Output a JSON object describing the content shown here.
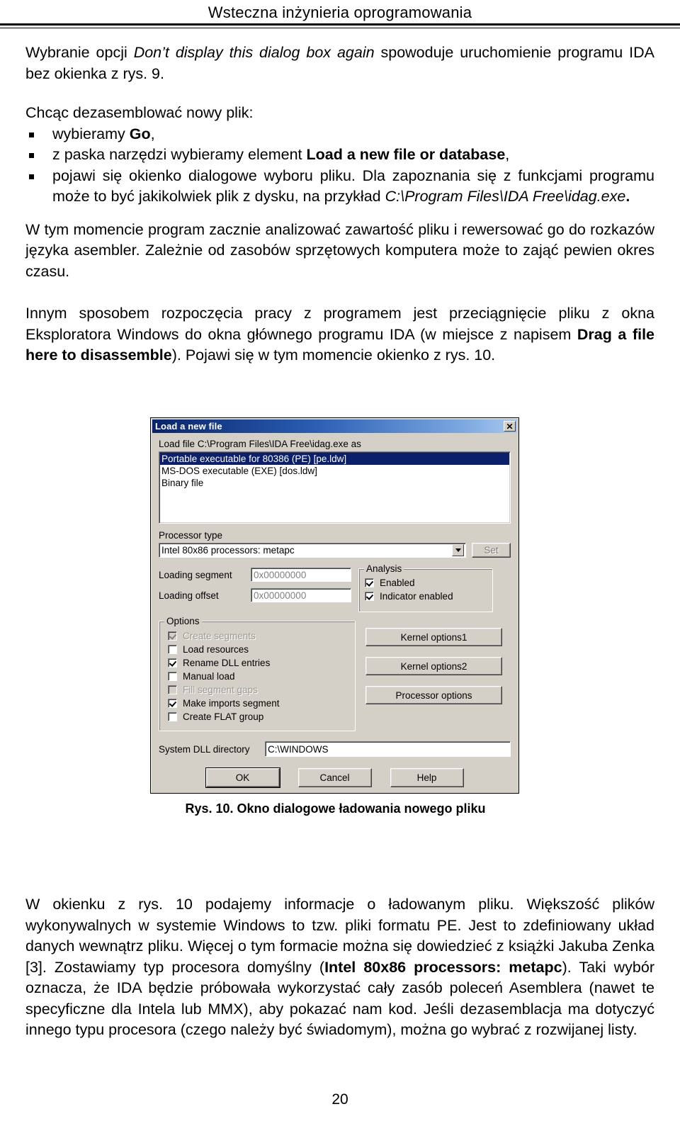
{
  "header": {
    "running_title": "Wsteczna inżynieria oprogramowania"
  },
  "body": {
    "para1_a": "Wybranie opcji ",
    "para1_italic": "Don’t display this dialog box again",
    "para1_b": " spowoduje uruchomienie programu IDA bez okienka z rys. 9.",
    "intro_list": "Chcąc dezasemblować nowy plik:",
    "bullets": [
      {
        "pre": "wybieramy ",
        "bold": "Go",
        "post": ","
      },
      {
        "pre": "z paska narzędzi wybieramy element ",
        "bold": "Load a new file or database",
        "post": ","
      },
      {
        "pre": "pojawi się okienko dialogowe wyboru pliku. Dla zapoznania się z funkcjami programu może to być jakikolwiek plik z dysku, na przykład ",
        "italic": "C:\\Program Files\\IDA Free\\idag.exe",
        "post": "."
      }
    ],
    "para2": "W tym momencie program zacznie analizować zawartość pliku i rewersować go do rozkazów języka asembler. Zależnie od zasobów sprzętowych komputera może to zająć pewien okres czasu.",
    "para3_a": "Innym sposobem rozpoczęcia pracy z programem jest przeciągnięcie pliku z okna Eksploratora Windows do okna głównego programu IDA (w miejsce z napisem ",
    "para3_bold": "Drag a file here to disassemble",
    "para3_b": "). Pojawi się w tym momencie okienko z rys. 10.",
    "para4_a": "W okienku z rys. 10 podajemy informacje o ładowanym pliku. Większość plików wykonywalnych w systemie Windows to tzw. pliki formatu PE. Jest to zdefiniowany układ danych wewnątrz pliku. Więcej o tym formacie można się dowiedzieć z książki Jakuba Zenka [3]. Zostawiamy typ procesora domyślny (",
    "para4_bold": "Intel 80x86 processors: metapc",
    "para4_b": "). Taki wybór oznacza, że IDA będzie próbowała wykorzystać cały zasób poleceń Asemblera (nawet te specyficzne dla Intela lub MMX), aby pokazać nam kod. Jeśli dezasemblacja ma dotyczyć innego typu procesora (czego należy być świadomym), można go wybrać z rozwijanej listy."
  },
  "figure": {
    "caption": "Rys.  10. Okno dialogowe ładowania nowego pliku",
    "dialog": {
      "title": "Load a new file",
      "close_icon": "✕",
      "load_file_label": "Load file C:\\Program Files\\IDA Free\\idag.exe as",
      "file_types": [
        {
          "label": "Portable executable for 80386 (PE) [pe.ldw]",
          "selected": true
        },
        {
          "label": "MS-DOS executable (EXE) [dos.ldw]",
          "selected": false
        },
        {
          "label": "Binary file",
          "selected": false
        }
      ],
      "processor_type_label": "Processor type",
      "processor_type_value": "Intel 80x86 processors: metapc",
      "set_button": "Set",
      "loading_segment_label": "Loading segment",
      "loading_segment_value": "0x00000000",
      "loading_offset_label": "Loading offset",
      "loading_offset_value": "0x00000000",
      "analysis_group": "Analysis",
      "analysis_options": [
        {
          "label": "Enabled",
          "checked": true,
          "disabled": false
        },
        {
          "label": "Indicator enabled",
          "checked": true,
          "disabled": false
        }
      ],
      "options_group": "Options",
      "options": [
        {
          "label": "Create segments",
          "checked": true,
          "disabled": true
        },
        {
          "label": "Load resources",
          "checked": false,
          "disabled": false
        },
        {
          "label": "Rename DLL entries",
          "checked": true,
          "disabled": false
        },
        {
          "label": "Manual load",
          "checked": false,
          "disabled": false
        },
        {
          "label": "Fill segment gaps",
          "checked": false,
          "disabled": true
        },
        {
          "label": "Make imports segment",
          "checked": true,
          "disabled": false
        },
        {
          "label": "Create FLAT group",
          "checked": false,
          "disabled": false
        }
      ],
      "side_buttons": [
        "Kernel options1",
        "Kernel options2",
        "Processor options"
      ],
      "dll_dir_label": "System DLL directory",
      "dll_dir_value": "C:\\WINDOWS",
      "bottom_buttons": [
        {
          "label": "OK",
          "default": true
        },
        {
          "label": "Cancel",
          "default": false
        },
        {
          "label": "Help",
          "default": false
        }
      ]
    }
  },
  "footer": {
    "page_number": "20"
  },
  "colors": {
    "title_bar_start": "#0a246a",
    "title_bar_end": "#a6c8ef",
    "dialog_face": "#d4d0c8",
    "selection": "#0b1f6b"
  }
}
